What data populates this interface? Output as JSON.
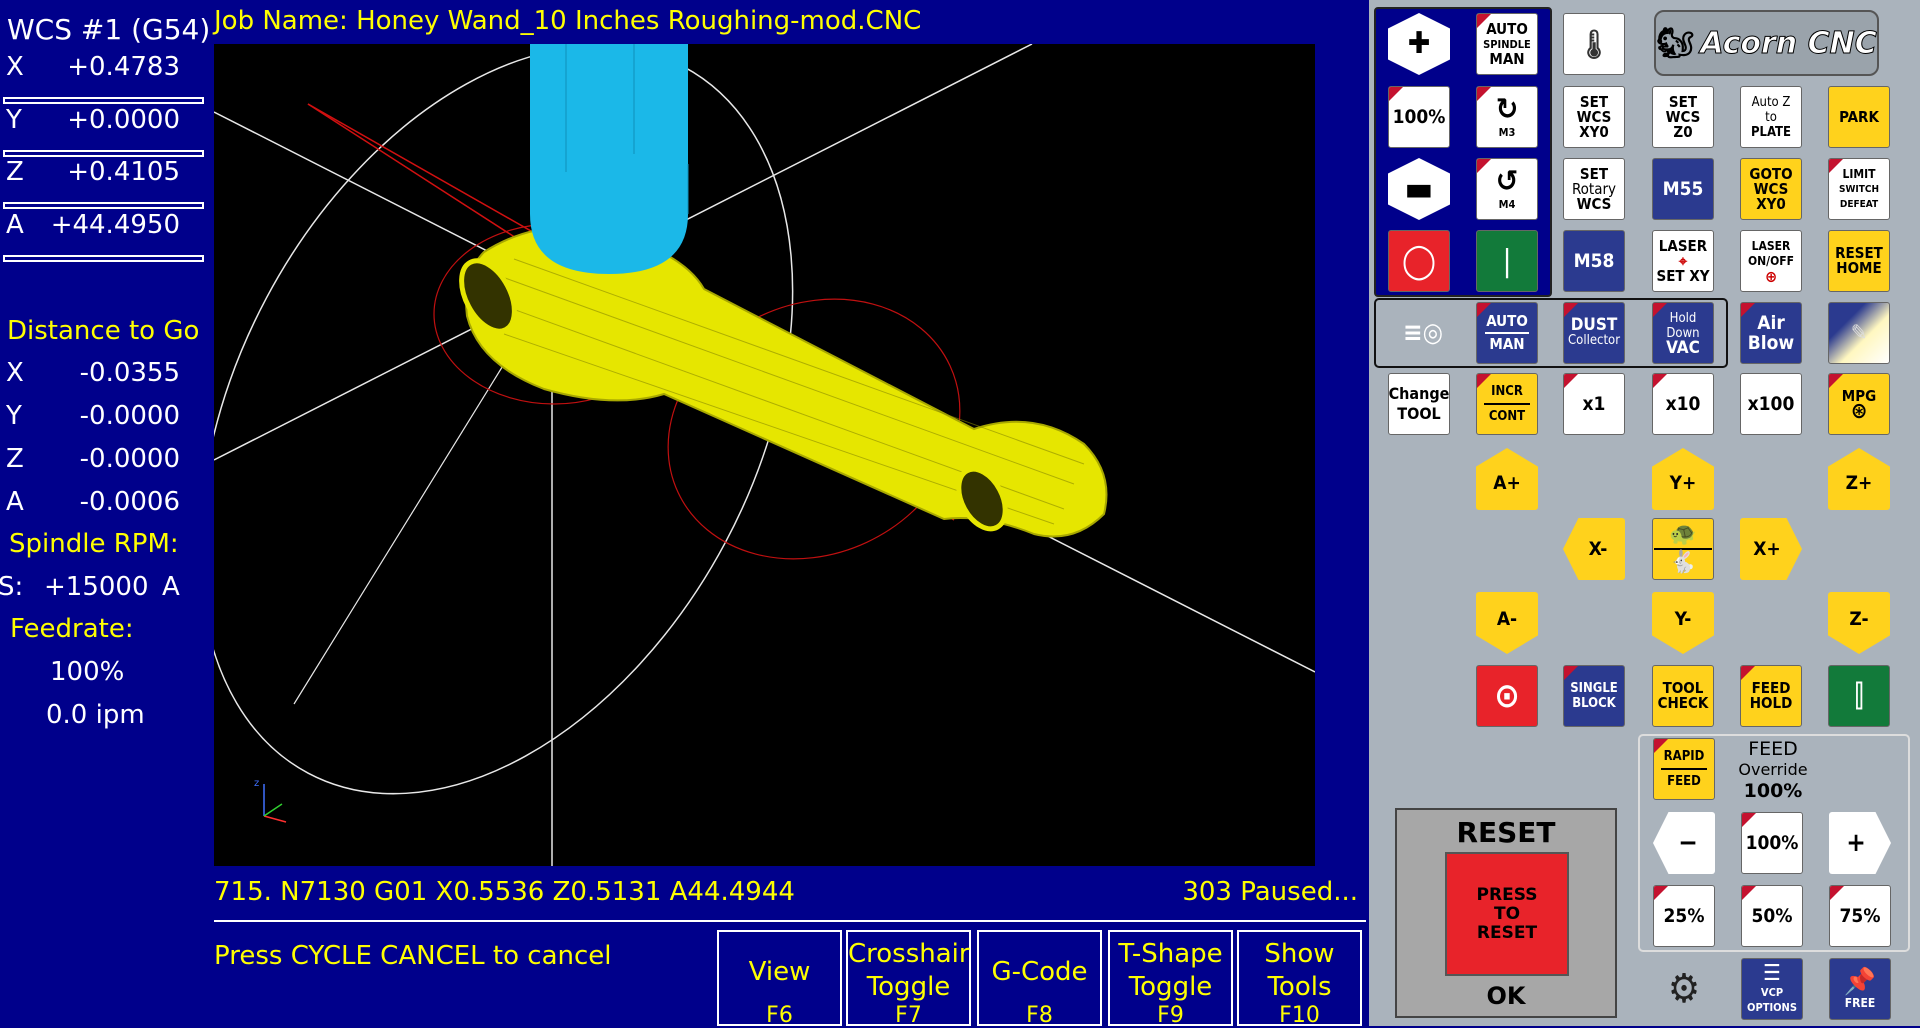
{
  "dro": {
    "wcs": "WCS #1 (G54)",
    "axes": [
      {
        "axis": "X",
        "value": "+0.4783"
      },
      {
        "axis": "Y",
        "value": "+0.0000"
      },
      {
        "axis": "Z",
        "value": "+0.4105"
      },
      {
        "axis": "A",
        "value": "+44.4950"
      }
    ],
    "dtg_title": "Distance to Go",
    "dtg": [
      {
        "axis": "X",
        "value": "-0.0355"
      },
      {
        "axis": "Y",
        "value": "-0.0000"
      },
      {
        "axis": "Z",
        "value": "-0.0000"
      },
      {
        "axis": "A",
        "value": "-0.0006"
      }
    ],
    "spindle_title": "Spindle RPM:",
    "spindle_prefix": "S:",
    "spindle_value": "+15000",
    "spindle_suffix": "A",
    "feed_title": "Feedrate:",
    "feed_pct": "100%",
    "feed_ipm": "0.0 ipm"
  },
  "job": {
    "label": "Job Name: Honey Wand_10 Inches Roughing-mod.CNC"
  },
  "gcode_line": "715. N7130 G01 X0.5536 Z0.5131 A44.4944",
  "run_status": "303 Paused...",
  "message": "Press CYCLE CANCEL to cancel",
  "fkeys": [
    {
      "label": "View",
      "key": "F6"
    },
    {
      "label": "Crosshair\nToggle",
      "key": "F7"
    },
    {
      "label": "G-Code",
      "key": "F8"
    },
    {
      "label": "T-Shape\nToggle",
      "key": "F9"
    },
    {
      "label": "Show\nTools",
      "key": "F10"
    }
  ],
  "buttons": {
    "auto_spindle": [
      "AUTO",
      "SPINDLE",
      "MAN"
    ],
    "pct100": "100%",
    "m3": "M3",
    "m4": "M4",
    "set_wcs_xy0": [
      "SET",
      "WCS",
      "XY0"
    ],
    "set_wcs_z0": [
      "SET",
      "WCS",
      "Z0"
    ],
    "auto_z": [
      "Auto Z",
      "to",
      "PLATE"
    ],
    "park": "PARK",
    "set_rotary": [
      "SET",
      "Rotary",
      "WCS"
    ],
    "m55": "M55",
    "goto_wcs": [
      "GOTO",
      "WCS",
      "XY0"
    ],
    "limit_defeat": [
      "LIMIT",
      "SWITCH",
      "DEFEAT"
    ],
    "m58": "M58",
    "laser_set": [
      "LASER",
      "SET XY"
    ],
    "laser_onoff": [
      "LASER",
      "ON/OFF"
    ],
    "reset_home": [
      "RESET",
      "HOME"
    ],
    "vac_auto": [
      "AUTO",
      "MAN"
    ],
    "dust": [
      "DUST",
      "Collector"
    ],
    "hold_vac": [
      "Hold",
      "Down",
      "VAC"
    ],
    "air_blow": [
      "Air",
      "Blow"
    ],
    "change_tool": [
      "Change",
      "TOOL"
    ],
    "incr_cont": [
      "INCR",
      "CONT"
    ],
    "x1": "x1",
    "x10": "x10",
    "x100": "x100",
    "mpg": "MPG",
    "a_plus": "A+",
    "y_plus": "Y+",
    "z_plus": "Z+",
    "x_minus": "X-",
    "x_plus": "X+",
    "a_minus": "A-",
    "y_minus": "Y-",
    "z_minus": "Z-",
    "single_block": [
      "SINGLE",
      "BLOCK"
    ],
    "tool_check": [
      "TOOL",
      "CHECK"
    ],
    "feed_hold": [
      "FEED",
      "HOLD"
    ],
    "rapid_feed": [
      "RAPID",
      "FEED"
    ],
    "feed_minus": "−",
    "feed_100": "100%",
    "feed_plus": "+",
    "feed_25": "25%",
    "feed_50": "50%",
    "feed_75": "75%",
    "vcp_options": [
      "VCP",
      "OPTIONS"
    ],
    "free": "FREE"
  },
  "feed_override": {
    "title": "FEED",
    "sub": "Override",
    "value": "100%"
  },
  "reset": {
    "title": "RESET",
    "button": [
      "PRESS",
      "TO",
      "RESET"
    ],
    "state": "OK"
  },
  "logo": {
    "text": "Acorn CNC"
  },
  "colors": {
    "background": "#00008b",
    "accent_yellow": "#ffd21c",
    "toolpath": "#e6e600",
    "tool": "#1bb8e8"
  }
}
